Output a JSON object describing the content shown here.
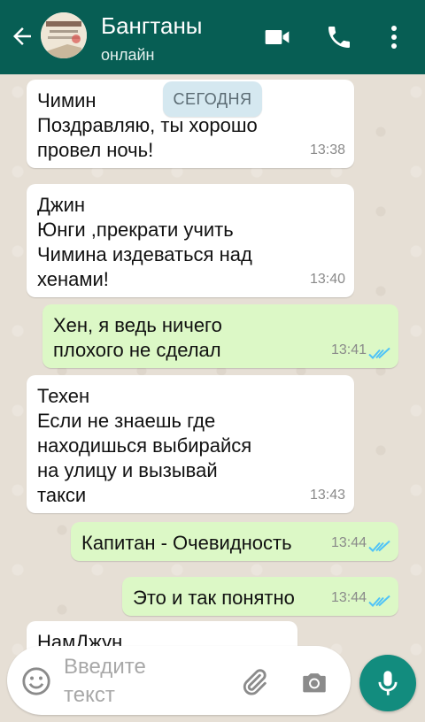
{
  "header": {
    "title": "Бангтаны",
    "status": "онлайн"
  },
  "chat": {
    "date_divider": "СЕГОДНЯ",
    "messages": [
      {
        "direction": "in",
        "sender": "Чимин",
        "text": "Поздравляю, ты хорошо\nпровел ночь!",
        "time": "13:38"
      },
      {
        "direction": "in",
        "sender": "Джин",
        "text": "Юнги ,прекрати учить\nЧимина издеваться над\nхенами!",
        "time": "13:40"
      },
      {
        "direction": "out",
        "text": "Хен, я ведь ничего\nплохого не сделал",
        "time": "13:41",
        "read": true
      },
      {
        "direction": "in",
        "sender": "Техен",
        "text": "Если не знаешь где\nнаходишься выбирайся\nна улицу и вызывай\nтакси",
        "time": "13:43"
      },
      {
        "direction": "out",
        "text": "Капитан - Очевидность",
        "time": "13:44",
        "read": true
      },
      {
        "direction": "out",
        "text": "Это и так понятно",
        "time": "13:44",
        "read": true
      },
      {
        "direction": "in",
        "sender": "НамДжун",
        "text": "",
        "time": ""
      }
    ]
  },
  "input": {
    "placeholder": "Введите\nтекст"
  },
  "icons": {
    "back": "arrow-left-icon",
    "video": "video-camera-icon",
    "call": "phone-icon",
    "more": "more-vertical-icon",
    "emoji": "emoji-icon",
    "attach": "paperclip-icon",
    "camera": "camera-icon",
    "mic": "microphone-icon",
    "read_receipt": "double-check-icon"
  },
  "colors": {
    "header": "#075e54",
    "outgoing_bubble": "#dcf8c6",
    "incoming_bubble": "#ffffff",
    "mic_button": "#128c7e",
    "read_ticks": "#4fc3f7"
  }
}
